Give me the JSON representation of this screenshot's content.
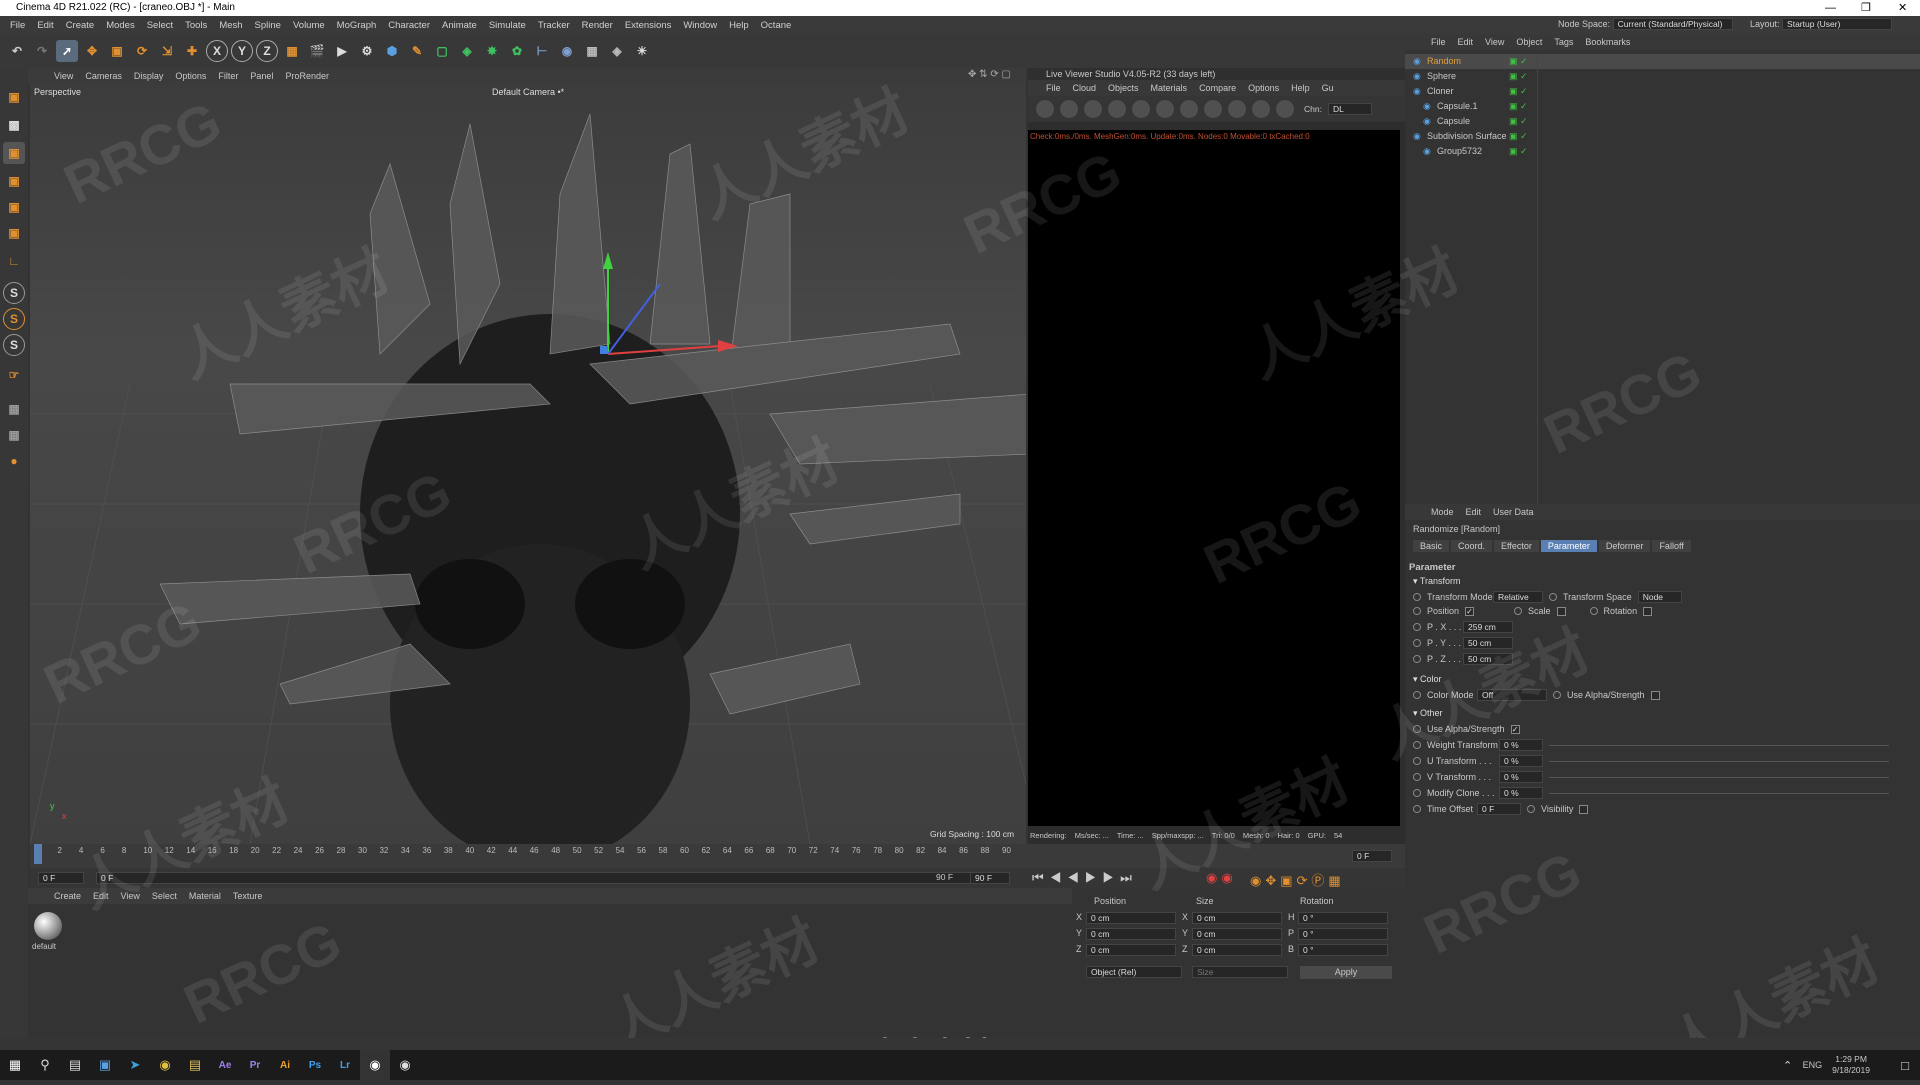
{
  "window": {
    "title": "Cinema 4D R21.022 (RC) - [craneo.OBJ *] - Main",
    "watermark_url": "www.rrcg.cn"
  },
  "menu": [
    "File",
    "Edit",
    "Create",
    "Modes",
    "Select",
    "Tools",
    "Mesh",
    "Spline",
    "Volume",
    "MoGraph",
    "Character",
    "Animate",
    "Simulate",
    "Tracker",
    "Render",
    "Extensions",
    "Window",
    "Help",
    "Octane"
  ],
  "nodespace": {
    "label": "Node Space:",
    "value": "Current (Standard/Physical)"
  },
  "layout": {
    "label": "Layout:",
    "value": "Startup (User)"
  },
  "toolbar": {
    "x_label": "X",
    "y_label": "Y",
    "z_label": "Z"
  },
  "viewport": {
    "menu": [
      "View",
      "Cameras",
      "Display",
      "Options",
      "Filter",
      "Panel",
      "ProRender"
    ],
    "perspective": "Perspective",
    "camera": "Default Camera •*",
    "grid_spacing": "Grid Spacing : 100 cm"
  },
  "timeline": {
    "ticks": [
      "0",
      "2",
      "4",
      "6",
      "8",
      "10",
      "12",
      "14",
      "16",
      "18",
      "20",
      "22",
      "24",
      "26",
      "28",
      "30",
      "32",
      "34",
      "36",
      "38",
      "40",
      "42",
      "44",
      "46",
      "48",
      "50",
      "52",
      "54",
      "56",
      "58",
      "60",
      "62",
      "64",
      "66",
      "68",
      "70",
      "72",
      "74",
      "76",
      "78",
      "80",
      "82",
      "84",
      "86",
      "88",
      "90"
    ],
    "end_frame": "0 F"
  },
  "timectl": {
    "start": "0 F",
    "current": "0 F",
    "end1": "90 F",
    "end2": "90 F"
  },
  "live_viewer": {
    "title": "Live Viewer Studio V4.05-R2 (33 days left)",
    "menu": [
      "File",
      "Cloud",
      "Objects",
      "Materials",
      "Compare",
      "Options",
      "Help",
      "Gu"
    ],
    "chn_label": "Chn:",
    "chn_value": "DL",
    "status": "Check:0ms./0ms. MeshGen:0ms. Update:0ms. Nodes:0 Movable:0 txCached:0",
    "footer": {
      "rendering": "Rendering:",
      "ms": "Ms/sec: ...",
      "time": "Time: ...",
      "spp": "Spp/maxspp: ...",
      "tri": "Tri: 0/0",
      "mesh": "Mesh: 0",
      "hair": "Hair: 0",
      "gpu": "GPU:",
      "gpu_val": "54"
    }
  },
  "objects": {
    "menu": [
      "File",
      "Edit",
      "View",
      "Object",
      "Tags",
      "Bookmarks"
    ],
    "items": [
      {
        "name": "Random",
        "indent": 0,
        "color": "#e0a040"
      },
      {
        "name": "Sphere",
        "indent": 0,
        "color": "#c8c8c8"
      },
      {
        "name": "Cloner",
        "indent": 0,
        "color": "#c8c8c8"
      },
      {
        "name": "Capsule.1",
        "indent": 1,
        "color": "#c8c8c8"
      },
      {
        "name": "Capsule",
        "indent": 1,
        "color": "#c8c8c8"
      },
      {
        "name": "Subdivision Surface",
        "indent": 0,
        "color": "#c8c8c8"
      },
      {
        "name": "Group5732",
        "indent": 1,
        "color": "#c8c8c8"
      }
    ]
  },
  "attributes": {
    "menu": [
      "Mode",
      "Edit",
      "User Data"
    ],
    "object": "Randomize [Random]",
    "tabs": [
      "Basic",
      "Coord.",
      "Effector",
      "Parameter",
      "Deformer",
      "Falloff"
    ],
    "active_tab": "Parameter",
    "section": "Parameter",
    "transform": "Transform",
    "transform_mode_label": "Transform Mode",
    "transform_mode": "Relative",
    "transform_space_label": "Transform Space",
    "transform_space": "Node",
    "position": "Position",
    "scale": "Scale",
    "rotation": "Rotation",
    "px_label": "P . X . . .",
    "px": "259 cm",
    "py_label": "P . Y . . .",
    "py": "50 cm",
    "pz_label": "P . Z . . .",
    "pz": "50 cm",
    "color": "Color",
    "color_mode_label": "Color Mode",
    "color_mode": "Off",
    "use_alpha_label": "Use Alpha/Strength",
    "other": "Other",
    "use_alpha2": "Use Alpha/Strength",
    "weight_label": "Weight Transform",
    "weight": "0 %",
    "u_label": "U Transform . . .",
    "u": "0 %",
    "v_label": "V Transform . . .",
    "v": "0 %",
    "modify_label": "Modify Clone . . .",
    "modify": "0 %",
    "time_label": "Time Offset",
    "time": "0 F",
    "visibility": "Visibility"
  },
  "material": {
    "menu": [
      "Create",
      "Edit",
      "View",
      "Select",
      "Material",
      "Texture"
    ],
    "name": "default"
  },
  "coords": {
    "position": "Position",
    "size": "Size",
    "rotation": "Rotation",
    "x": "0 cm",
    "y": "0 cm",
    "z": "0 cm",
    "sx": "0 cm",
    "sy": "0 cm",
    "sz": "0 cm",
    "h": "0 °",
    "p": "0 °",
    "b": "0 °",
    "mode": "Object (Rel)",
    "size_mode": "Size",
    "apply": "Apply"
  },
  "watermarks": {
    "a": "RRCG",
    "b": "人人素材"
  },
  "taskbar": {
    "lang": "ENG",
    "time": "1:29 PM",
    "date": "9/18/2019"
  }
}
